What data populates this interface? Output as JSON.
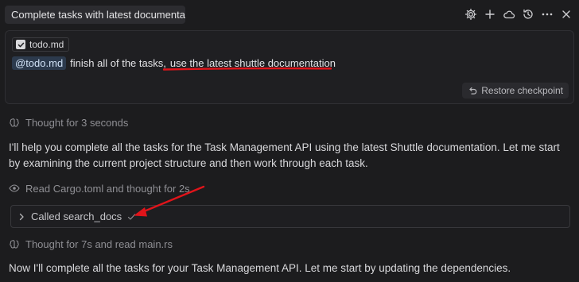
{
  "header": {
    "chat_title": "Complete tasks with latest documentation",
    "icons": [
      "gear-icon",
      "plus-icon",
      "cloud-icon",
      "history-icon",
      "more-icon",
      "close-icon"
    ]
  },
  "composer": {
    "context_chip_label": "todo.md",
    "mention": "@todo.md",
    "message_text_plain": "finish all of the tasks,",
    "message_text_highlight": "use the latest shuttle documentation",
    "restore_label": "Restore checkpoint"
  },
  "conversation": {
    "thought_1": "Thought for 3 seconds",
    "paragraph_1": "I'll help you complete all the tasks for the Task Management API using the latest Shuttle documentation. Let me start by examining the current project structure and then work through each task.",
    "read_step": "Read Cargo.toml and thought for 2s",
    "tool_call_label": "Called search_docs",
    "thought_2": "Thought for 7s and read main.rs",
    "paragraph_2": "Now I'll complete all the tasks for your Task Management API. Let me start by updating the dependencies."
  },
  "colors": {
    "background": "#1c1c1e",
    "annotation_red": "#e0141a",
    "mention_bg": "#2c3a4d"
  }
}
